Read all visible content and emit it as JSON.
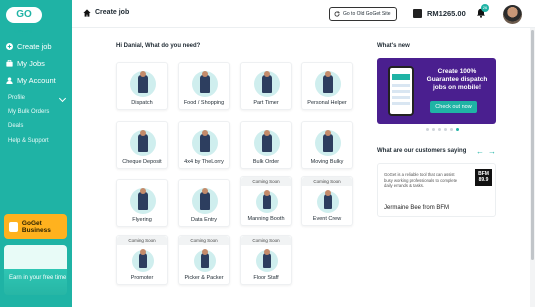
{
  "brand": {
    "logo_text": "GO GET",
    "accent": "#1fb3a5"
  },
  "sidebar": {
    "items": [
      {
        "label": "Create job",
        "icon": "plus-circle-icon"
      },
      {
        "label": "My Jobs",
        "icon": "briefcase-icon"
      },
      {
        "label": "My Account",
        "icon": "user-icon"
      }
    ],
    "profile": {
      "label": "Profile",
      "children": [
        "My Bulk Orders",
        "Deals",
        "Help & Support"
      ]
    },
    "business_card": {
      "label": "GoGet Business"
    },
    "earn_card": {
      "label": "Earn in your free time"
    }
  },
  "topbar": {
    "title": "Create job",
    "old_site_label": "Go to Old GoGet Site",
    "balance": "RM1265.00",
    "notification_count": "26"
  },
  "main": {
    "greeting": "Hi Danial, What do you need?",
    "coming_soon_label": "Coming Soon",
    "tiles": [
      {
        "label": "Dispatch",
        "coming_soon": false
      },
      {
        "label": "Food / Shopping",
        "coming_soon": false
      },
      {
        "label": "Part Timer",
        "coming_soon": false
      },
      {
        "label": "Personal Helper",
        "coming_soon": false
      },
      {
        "label": "Cheque Deposit",
        "coming_soon": false
      },
      {
        "label": "4x4 by TheLorry",
        "coming_soon": false
      },
      {
        "label": "Bulk Order",
        "coming_soon": false
      },
      {
        "label": "Moving Bulky",
        "coming_soon": false
      },
      {
        "label": "Flyering",
        "coming_soon": false
      },
      {
        "label": "Data Entry",
        "coming_soon": false
      },
      {
        "label": "Manning Booth",
        "coming_soon": true
      },
      {
        "label": "Event Crew",
        "coming_soon": true
      },
      {
        "label": "Promoter",
        "coming_soon": true
      },
      {
        "label": "Picker & Packer",
        "coming_soon": true
      },
      {
        "label": "Floor Staff",
        "coming_soon": true
      }
    ]
  },
  "right": {
    "whats_new_title": "What's new",
    "promo": {
      "headline": "Create 100% Guarantee dispatch jobs on mobile!",
      "button": "Check out now"
    },
    "customers_title": "What are our customers saying",
    "testimonial": {
      "quote": "GoGet is a reliable tool that can assist busy working professionals to complete daily errands & tasks.",
      "author": "Jermaine Bee from BFM",
      "logo_text": "BFM 89.9"
    }
  }
}
